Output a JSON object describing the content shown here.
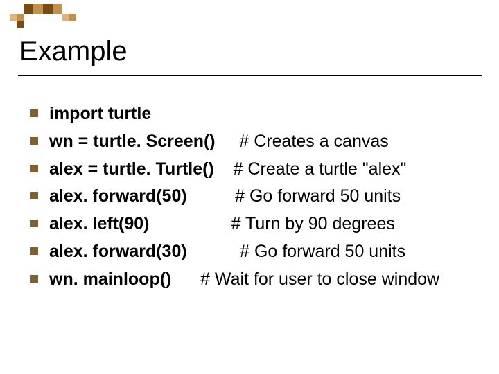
{
  "title": "Example",
  "lines": [
    {
      "code": "import turtle",
      "comment": ""
    },
    {
      "code": "wn = turtle. Screen()     ",
      "comment": "# Creates a canvas"
    },
    {
      "code": "alex = turtle. Turtle()    ",
      "comment": "# Create a turtle \"alex\""
    },
    {
      "code": "alex. forward(50)          ",
      "comment": "# Go forward 50 units"
    },
    {
      "code": "alex. left(90)                 ",
      "comment": "# Turn by 90 degrees"
    },
    {
      "code": "alex. forward(30)           ",
      "comment": "# Go forward 50 units"
    },
    {
      "code": "wn. mainloop()      ",
      "comment": "# Wait for user to close window"
    }
  ]
}
